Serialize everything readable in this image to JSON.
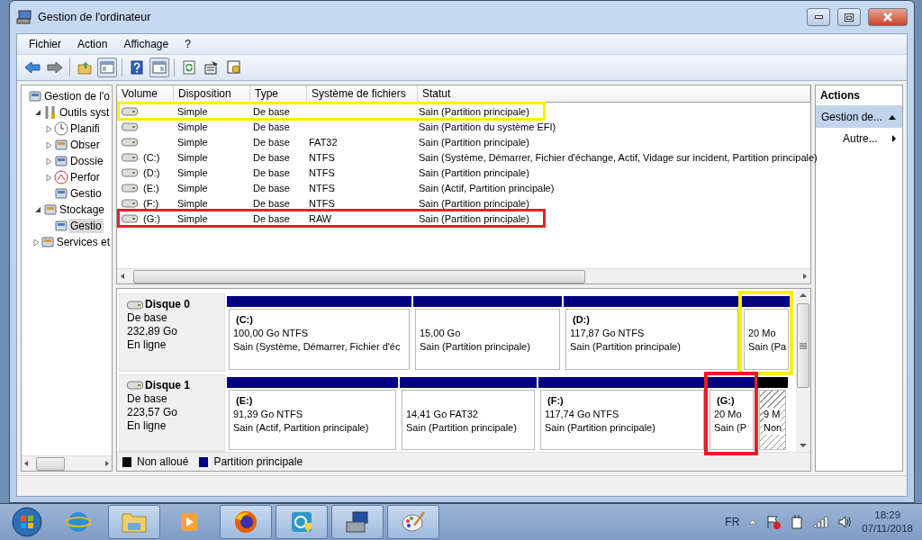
{
  "window": {
    "title": "Gestion de l'ordinateur"
  },
  "menu": [
    "Fichier",
    "Action",
    "Affichage",
    "?"
  ],
  "toolbar": [
    {
      "kind": "back",
      "pressed": false
    },
    {
      "kind": "forward",
      "pressed": false
    },
    {
      "kind": "up",
      "pressed": false
    },
    {
      "kind": "tree",
      "pressed": true
    },
    {
      "kind": "help",
      "pressed": false
    },
    {
      "kind": "pane",
      "pressed": true
    },
    {
      "kind": "refresh",
      "pressed": false
    },
    {
      "kind": "properties",
      "pressed": false
    },
    {
      "kind": "settings",
      "pressed": false
    }
  ],
  "tree": [
    {
      "label": "Gestion de l'o",
      "selected": false,
      "children": [
        {
          "label": "Outils syst",
          "expanded": true,
          "selected": false,
          "children": [
            {
              "label": "Planifi",
              "expanded": false,
              "selected": false
            },
            {
              "label": "Obser",
              "expanded": false,
              "selected": false
            },
            {
              "label": "Dossie",
              "expanded": false,
              "selected": false
            },
            {
              "label": "Perfor",
              "expanded": false,
              "selected": false
            },
            {
              "label": "Gestio",
              "selected": false
            }
          ]
        },
        {
          "label": "Stockage",
          "expanded": true,
          "selected": false,
          "children": [
            {
              "label": "Gestio",
              "selected": true
            }
          ]
        },
        {
          "label": "Services et",
          "expanded": false,
          "selected": false
        }
      ]
    }
  ],
  "table": {
    "columns": [
      "Volume",
      "Disposition",
      "Type",
      "Système de fichiers",
      "Statut"
    ],
    "rows": [
      {
        "cells": [
          "",
          "Simple",
          "De base",
          "",
          "Sain (Partition principale)"
        ],
        "color": "#ffee00"
      },
      {
        "cells": [
          "",
          "Simple",
          "De base",
          "",
          "Sain (Partition du système EFI)"
        ]
      },
      {
        "cells": [
          "",
          "Simple",
          "De base",
          "FAT32",
          "Sain (Partition principale)"
        ]
      },
      {
        "cells": [
          "(C:)",
          "Simple",
          "De base",
          "NTFS",
          "Sain (Système, Démarrer, Fichier d'échange, Actif, Vidage sur incident, Partition principale)"
        ]
      },
      {
        "cells": [
          "(D:)",
          "Simple",
          "De base",
          "NTFS",
          "Sain (Partition principale)"
        ]
      },
      {
        "cells": [
          "(E:)",
          "Simple",
          "De base",
          "NTFS",
          "Sain (Actif, Partition principale)"
        ]
      },
      {
        "cells": [
          "(F:)",
          "Simple",
          "De base",
          "NTFS",
          "Sain (Partition principale)"
        ]
      },
      {
        "cells": [
          "(G:)",
          "Simple",
          "De base",
          "RAW",
          "Sain (Partition principale)"
        ],
        "color": "#e3202a"
      }
    ]
  },
  "disks": [
    {
      "name": "Disque 0",
      "type": "De base",
      "size": "232,89 Go",
      "status": "En ligne",
      "partitions": [
        {
          "kind": "primary",
          "label": "(C:)",
          "size": "100,00 Go NTFS",
          "status": "Sain (Système, Démarrer, Fichier d'éc"
        },
        {
          "kind": "primary",
          "size": "15,00 Go",
          "status": "Sain (Partition principale)"
        },
        {
          "kind": "primary",
          "label": "(D:)",
          "size": "117,87 Go NTFS",
          "status": "Sain (Partition principale)"
        },
        {
          "kind": "primary",
          "size": "20 Mo",
          "status": "Sain (Pa",
          "color": "#ffee00"
        }
      ]
    },
    {
      "name": "Disque 1",
      "type": "De base",
      "size": "223,57 Go",
      "status": "En ligne",
      "partitions": [
        {
          "kind": "primary",
          "label": "(E:)",
          "size": "91,39 Go NTFS",
          "status": "Sain (Actif, Partition principale)"
        },
        {
          "kind": "primary",
          "size": "14,41 Go FAT32",
          "status": "Sain (Partition principale)"
        },
        {
          "kind": "primary",
          "label": "(F:)",
          "size": "117,74 Go NTFS",
          "status": "Sain (Partition principale)"
        },
        {
          "kind": "primary",
          "label": "(G:)",
          "size": "20 Mo",
          "status": "Sain (P",
          "color": "#e3202a"
        },
        {
          "kind": "unallocated",
          "size": "9 M",
          "status": "Non"
        }
      ]
    }
  ],
  "legend": [
    {
      "kind": "unallocated",
      "label": "Non alloué"
    },
    {
      "kind": "primary",
      "label": "Partition principale"
    }
  ],
  "actions": {
    "title": "Actions",
    "sections": [
      {
        "label": "Gestion de...",
        "expanded": true,
        "items": [
          "Autre..."
        ]
      }
    ]
  },
  "tray": {
    "language": "FR",
    "time": "18:29",
    "date": "07/11/2018"
  }
}
